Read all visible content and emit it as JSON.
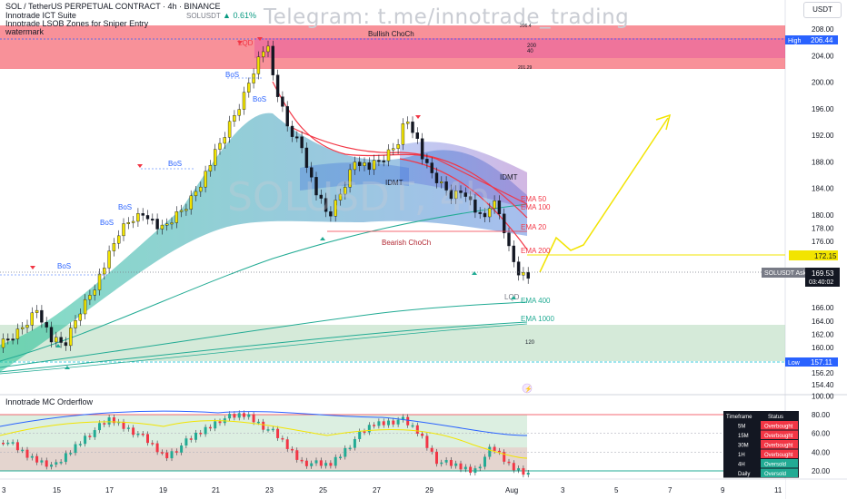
{
  "header": {
    "symbol": "SOL / TetherUS PERPETUAL CONTRACT · 4h · BINANCE",
    "indicator1": "Innotrade ICT Suite",
    "indicator2": "Innotrade LSOB Zones for Sniper Entry",
    "indicator3": "watermark",
    "pair_short": "SOLUSDT",
    "change": "0.61%"
  },
  "watermark_text": "Telegram: t.me/innotrade_trading",
  "big_watermark": "SOLUSDT, 4h",
  "currency": "USDT",
  "colors": {
    "accent_green": "#22ab94",
    "red": "#f23645",
    "yellow": "#f2e400",
    "blue": "#2962ff"
  },
  "price_axis": [
    "208.00",
    "204.00",
    "200.00",
    "196.00",
    "192.00",
    "188.00",
    "184.00",
    "180.00",
    "178.00",
    "176.00",
    "174.00",
    "166.00",
    "164.00",
    "162.00",
    "160.00",
    "158.00",
    "156.20",
    "154.40"
  ],
  "price_badges": {
    "high_label": "High",
    "high_value": "206.44",
    "level_value": "172.15",
    "ask_label": "SOLUSDT Ask",
    "ask_value": "169.53",
    "countdown": "03:40:02",
    "low_label": "Low",
    "low_value": "157.11"
  },
  "time_axis": [
    "3",
    "15",
    "17",
    "19",
    "21",
    "23",
    "25",
    "27",
    "29",
    "Aug",
    "3",
    "5",
    "7",
    "9",
    "11"
  ],
  "labels": {
    "bullish_choch": "Bullish ChoCh",
    "bearish_choch": "Bearish ChoCh",
    "bos": "BoS",
    "idmt": "IDMT",
    "lq": "LQD",
    "ema20": "EMA 20",
    "ema50": "EMA 50",
    "ema100": "EMA 100",
    "ema200": "EMA 200",
    "ema400": "EMA 400",
    "ema1000": "EMA 1000",
    "zone_top": "206.4",
    "zone_200": "200",
    "zone_40": "40",
    "zone_low": "201.29",
    "n120": "120"
  },
  "oscillator": {
    "title": "Innotrade MC Orderflow",
    "axis": [
      "100.00",
      "80.00",
      "60.00",
      "40.00",
      "20.00"
    ]
  },
  "status_table": {
    "headers": [
      "Timeframe",
      "Status"
    ],
    "rows": [
      {
        "tf": "5M",
        "status": "Overbought",
        "color": "#f23645"
      },
      {
        "tf": "15M",
        "status": "Overbought",
        "color": "#f23645"
      },
      {
        "tf": "30M",
        "status": "Overbought",
        "color": "#f23645"
      },
      {
        "tf": "1H",
        "status": "Overbought",
        "color": "#f23645"
      },
      {
        "tf": "4H",
        "status": "Oversold",
        "color": "#22ab94"
      },
      {
        "tf": "Daily",
        "status": "Oversold",
        "color": "#22ab94"
      }
    ]
  }
}
